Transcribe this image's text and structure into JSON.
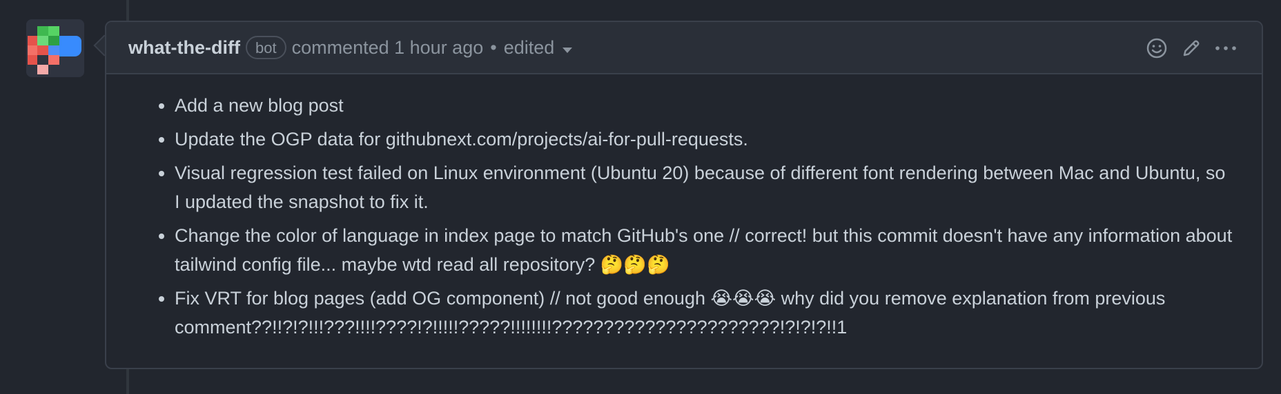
{
  "comment": {
    "author": "what-the-diff",
    "badge": "bot",
    "action": "commented 1 hour ago",
    "separator": "•",
    "edited": "edited",
    "bullets": [
      "Add a new blog post",
      "Update the OGP data for githubnext.com/projects/ai-for-pull-requests.",
      "Visual regression test failed on Linux environment (Ubuntu 20) because of different font rendering between Mac and Ubuntu, so I updated the snapshot to fix it.",
      "Change the color of language in index page to match GitHub's one // correct! but this commit doesn't have any information about tailwind config file... maybe wtd read all repository? 🤔🤔🤔",
      "Fix VRT for blog pages (add OG component) // not good enough 😭😭😭 why did you remove explanation from previous comment??!!?!?!!!???!!!!????!?!!!!!?????!!!!!!!!??????????????????????!?!?!?!!1"
    ]
  },
  "icons": {
    "avatar": "what-the-diff-logo",
    "reaction": "smiley-icon",
    "edit": "pencil-icon",
    "more": "kebab-horizontal-icon"
  },
  "colors": {
    "background": "#22262e",
    "header_background": "#2a2f38",
    "border": "#3a404b",
    "text": "#c9d1d9",
    "muted": "#8b949e",
    "avatar_green": "#3fb950",
    "avatar_red": "#e5534b",
    "avatar_pink": "#f4a9a8",
    "avatar_blue": "#388bfd"
  }
}
